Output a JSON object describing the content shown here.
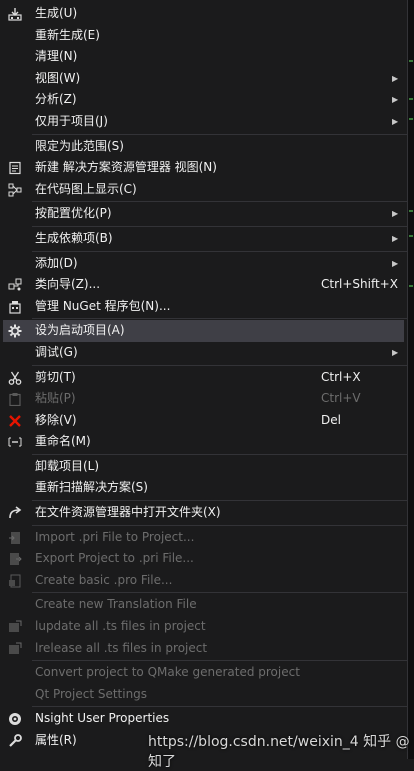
{
  "menu": {
    "items": [
      {
        "label": "生成(U)",
        "icon": "build-icon",
        "glyph": "⚙"
      },
      {
        "label": "重新生成(E)"
      },
      {
        "label": "清理(N)"
      },
      {
        "label": "视图(W)",
        "submenu": true
      },
      {
        "label": "分析(Z)",
        "submenu": true
      },
      {
        "label": "仅用于项目(J)",
        "submenu": true
      },
      {
        "label": "限定为此范围(S)"
      },
      {
        "label": "新建 解决方案资源管理器 视图(N)",
        "icon": "new-view-icon"
      },
      {
        "label": "在代码图上显示(C)",
        "icon": "code-map-icon"
      },
      {
        "label": "按配置优化(P)",
        "submenu": true
      },
      {
        "label": "生成依赖项(B)",
        "submenu": true
      },
      {
        "label": "添加(D)",
        "submenu": true
      },
      {
        "label": "类向导(Z)...",
        "shortcut": "Ctrl+Shift+X",
        "icon": "class-wizard-icon"
      },
      {
        "label": "管理 NuGet 程序包(N)...",
        "icon": "nuget-icon"
      },
      {
        "label": "设为启动项目(A)",
        "icon": "gear-icon",
        "selected": true
      },
      {
        "label": "调试(G)",
        "submenu": true
      },
      {
        "label": "剪切(T)",
        "shortcut": "Ctrl+X",
        "icon": "scissors-icon"
      },
      {
        "label": "粘贴(P)",
        "shortcut": "Ctrl+V",
        "icon": "paste-icon",
        "disabled": true
      },
      {
        "label": "移除(V)",
        "shortcut": "Del",
        "icon": "remove-icon"
      },
      {
        "label": "重命名(M)",
        "icon": "rename-icon"
      },
      {
        "label": "卸载项目(L)"
      },
      {
        "label": "重新扫描解决方案(S)"
      },
      {
        "label": "在文件资源管理器中打开文件夹(X)",
        "icon": "open-folder-icon"
      },
      {
        "label": "Import .pri File to Project...",
        "icon": "import-icon",
        "disabled": true
      },
      {
        "label": "Export Project to .pri File...",
        "icon": "export-icon",
        "disabled": true
      },
      {
        "label": "Create basic .pro File...",
        "icon": "pro-file-icon",
        "disabled": true
      },
      {
        "label": "Create new Translation File",
        "disabled": true
      },
      {
        "label": "lupdate all .ts files in project",
        "icon": "lupdate-icon",
        "disabled": true
      },
      {
        "label": "lrelease all .ts files in project",
        "icon": "lrelease-icon",
        "disabled": true
      },
      {
        "label": "Convert project to QMake generated project",
        "disabled": true
      },
      {
        "label": "Qt Project Settings",
        "disabled": true
      },
      {
        "label": "Nsight User Properties",
        "icon": "nsight-icon"
      },
      {
        "label": "属性(R)",
        "icon": "wrench-icon"
      }
    ]
  },
  "watermark": "https://blog.csdn.net/weixin_4 知乎 @知了",
  "colors": {
    "background": "#1b1b1c",
    "selected": "#3f3f46",
    "text": "#f1f1f1",
    "disabled_text": "#6d6d6d",
    "separator": "#333337",
    "remove_red": "#e51400"
  }
}
